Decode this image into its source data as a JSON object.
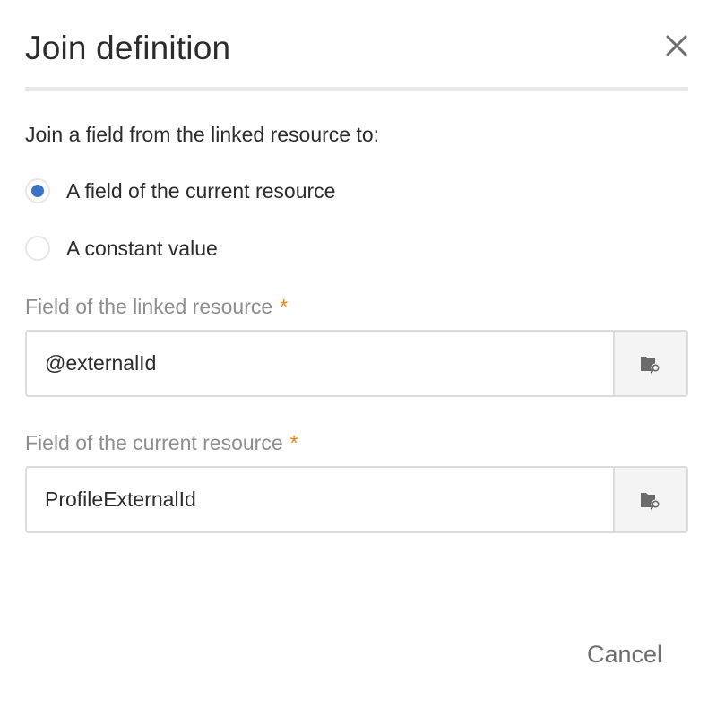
{
  "dialog": {
    "title": "Join definition",
    "close_icon": "close-icon",
    "prompt": "Join a field from the linked resource to:",
    "options": [
      {
        "label": "A field of the current resource",
        "checked": true
      },
      {
        "label": "A constant value",
        "checked": false
      }
    ],
    "fields": [
      {
        "label": "Field of the linked resource",
        "required_mark": "*",
        "value": "@externalId",
        "picker_icon": "folder-search-icon"
      },
      {
        "label": "Field of the current resource",
        "required_mark": "*",
        "value": "ProfileExternalId",
        "picker_icon": "folder-search-icon"
      }
    ],
    "cancel_label": "Cancel"
  },
  "colors": {
    "accent": "#3a73c8",
    "required": "#e68619",
    "label_muted": "#8e8e8e",
    "text": "#2c2c2c"
  }
}
